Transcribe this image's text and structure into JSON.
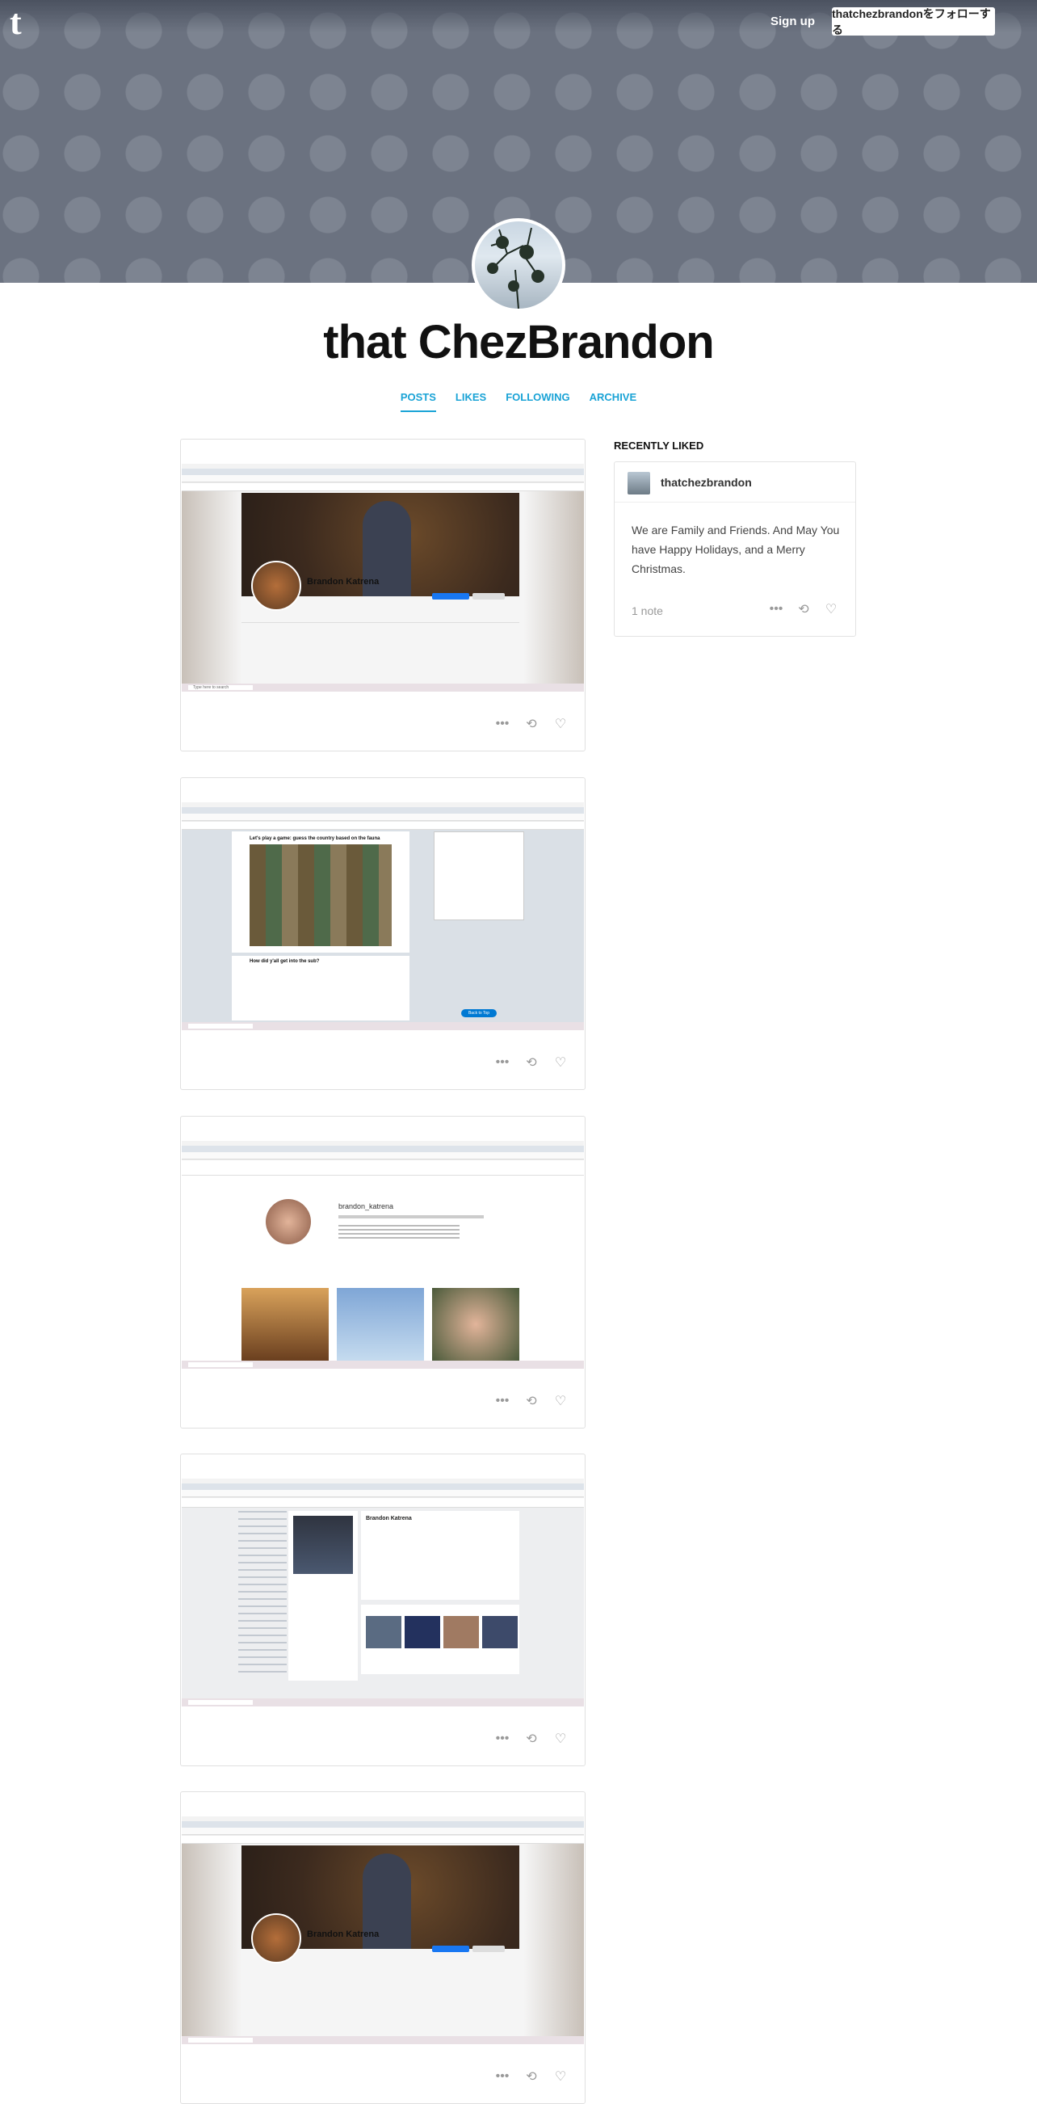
{
  "header": {
    "signup_label": "Sign up",
    "follow_label": "thatchezbrandonをフォローする",
    "blog_title": "that ChezBrandon"
  },
  "tabs": [
    {
      "label": "POSTS",
      "active": true
    },
    {
      "label": "LIKES"
    },
    {
      "label": "FOLLOWING"
    },
    {
      "label": "ARCHIVE"
    }
  ],
  "posts": [
    {
      "image": "facebook-profile-screenshot",
      "profile_name": "Brandon Katrena",
      "taskbar_search": "Type here to search"
    },
    {
      "image": "reddit-feed-screenshot",
      "post_title": "Let's play a game: guess the country based on the fauna",
      "post_title2": "How did y'all get into the sub?",
      "back_to_top": "Back to Top",
      "taskbar_search": "Type here to search"
    },
    {
      "image": "instagram-profile-screenshot",
      "username": "brandon_katrena",
      "taskbar_search": "Type here to search"
    },
    {
      "image": "vk-profile-screenshot",
      "profile_name": "Brandon Katrena",
      "taskbar_search": "Type here to search"
    },
    {
      "image": "facebook-profile-screenshot",
      "profile_name": "Brandon Katrena",
      "taskbar_search": "Type here to search"
    }
  ],
  "sidebar": {
    "title": "RECENTLY LIKED",
    "liked": {
      "blog_name": "thatchezbrandon",
      "text": "We are Family and Friends. And May You have Happy Holidays, and a Merry Christmas.",
      "notes": "1 note"
    }
  },
  "colors": {
    "accent": "#1aa3d6",
    "header_bg": "#6b7280",
    "header_dots": "#7d8491"
  }
}
